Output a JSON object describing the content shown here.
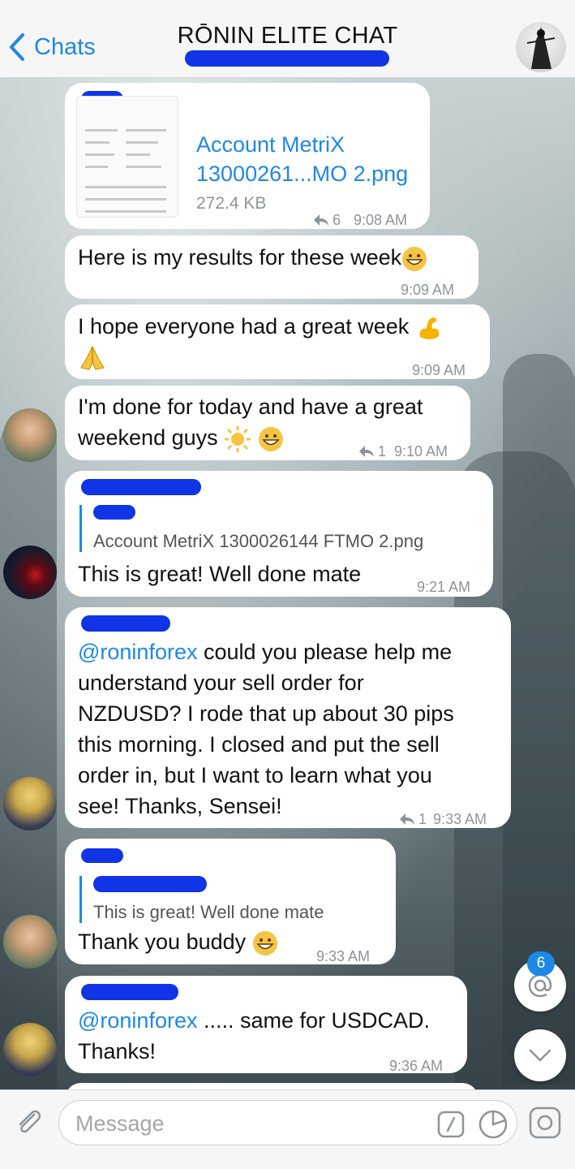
{
  "header": {
    "back_label": "Chats",
    "title": "RŌNIN ELITE CHAT"
  },
  "messages": {
    "file": {
      "filename_line1": "Account MetriX",
      "filename_line2": "13000261...MO 2.png",
      "size": "272.4 KB",
      "replies": "6",
      "time": "9:08 AM"
    },
    "m1": {
      "text": "Here is my results for these week",
      "time": "9:09 AM"
    },
    "m2": {
      "text": "I hope everyone had a great week",
      "time": "9:09 AM"
    },
    "m3": {
      "line1": "I'm done for today and have a great",
      "line2": "weekend guys",
      "replies": "1",
      "time": "9:10 AM"
    },
    "m4": {
      "quote": "Account MetriX 1300026144  FTMO 2.png",
      "text": "This is great! Well done mate",
      "time": "9:21 AM"
    },
    "m5": {
      "mention": "@roninforex",
      "line1": " could you please help me",
      "line2": "understand your sell order for",
      "line3": "NZDUSD?  I rode that up about 30 pips",
      "line4": "this morning.  I closed and put the sell",
      "line5": "order in, but I want to learn what you",
      "line6": "see!  Thanks, Sensei!",
      "replies": "1",
      "time": "9:33 AM"
    },
    "m6": {
      "quote": "This is great! Well done mate",
      "text": "Thank you buddy",
      "time": "9:33 AM"
    },
    "m7": {
      "mention": "@roninforex",
      "line1": " ..... same for USDCAD.",
      "line2": "Thanks!",
      "time": "9:36 AM"
    }
  },
  "mentions_badge": "6",
  "composer": {
    "placeholder": "Message"
  },
  "colors": {
    "accent": "#1e88e5",
    "redaction": "#1034e6"
  }
}
